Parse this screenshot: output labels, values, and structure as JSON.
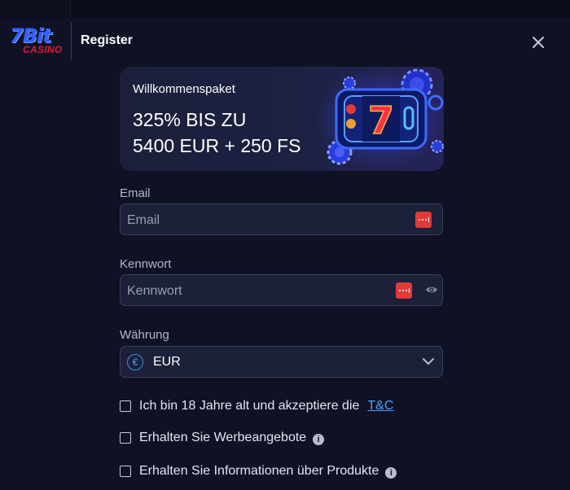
{
  "header": {
    "logo_top": "7Bit",
    "logo_bottom": "CASINO",
    "title": "Register"
  },
  "banner": {
    "subtitle": "Willkommenspaket",
    "line1": "325% BIS ZU",
    "line2": "5400 EUR + 250 FS"
  },
  "form": {
    "email_label": "Email",
    "email_placeholder": "Email",
    "password_label": "Kennwort",
    "password_placeholder": "Kennwort",
    "currency_label": "Währung",
    "currency_symbol": "€",
    "currency_value": "EUR"
  },
  "checkboxes": {
    "age_text": "Ich bin 18 Jahre alt und akzeptiere die",
    "tnc_link": "T&C",
    "promo_text": "Erhalten Sie Werbeangebote",
    "info_text": "Erhalten Sie Informationen über Produkte"
  },
  "icons": [
    "close-icon",
    "password-manager-icon",
    "eye-icon",
    "euro-icon",
    "chevron-down-icon",
    "info-icon"
  ],
  "colors": {
    "background": "#0f1224",
    "field_bg": "#1c2038",
    "link": "#4aa1ff",
    "badge": "#e03a3a",
    "logo_blue": "#2d62ff",
    "logo_red": "#e6143a"
  }
}
